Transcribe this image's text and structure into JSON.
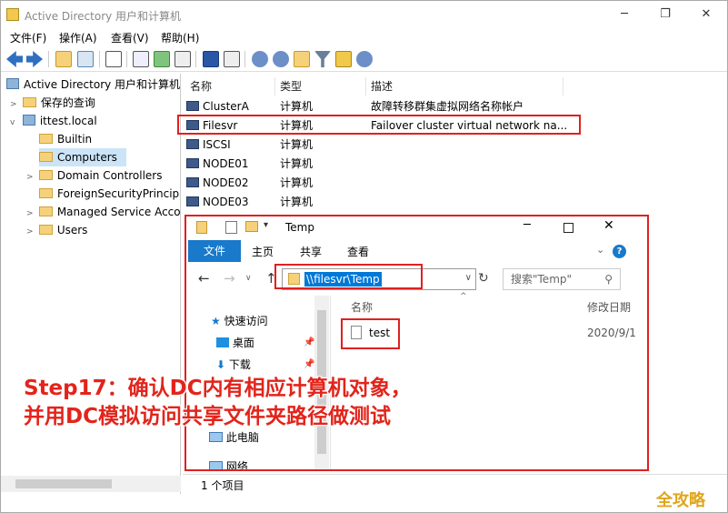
{
  "window": {
    "title": "Active Directory 用户和计算机",
    "minimize": "─",
    "maximize": "❐",
    "close": "✕"
  },
  "menu": [
    "文件(F)",
    "操作(A)",
    "查看(V)",
    "帮助(H)"
  ],
  "tree": {
    "root": "Active Directory 用户和计算机",
    "saved_queries": "保存的查询",
    "domain": "ittest.local",
    "children": [
      "Builtin",
      "Computers",
      "Domain Controllers",
      "ForeignSecurityPrincipa",
      "Managed Service Acco",
      "Users"
    ]
  },
  "list": {
    "headers": [
      "名称",
      "类型",
      "描述"
    ],
    "rows": [
      {
        "name": "ClusterA",
        "type": "计算机",
        "desc": "故障转移群集虚拟网络名称帐户"
      },
      {
        "name": "Filesvr",
        "type": "计算机",
        "desc": "Failover cluster virtual network na..."
      },
      {
        "name": "ISCSI",
        "type": "计算机",
        "desc": ""
      },
      {
        "name": "NODE01",
        "type": "计算机",
        "desc": ""
      },
      {
        "name": "NODE02",
        "type": "计算机",
        "desc": ""
      },
      {
        "name": "NODE03",
        "type": "计算机",
        "desc": ""
      }
    ]
  },
  "explorer": {
    "title": "Temp",
    "tabs": [
      "文件",
      "主页",
      "共享",
      "查看"
    ],
    "address": "\\\\filesvr\\Temp",
    "search_placeholder": "搜索\"Temp\"",
    "nav": [
      "快速访问",
      "桌面",
      "下载",
      "此电脑",
      "网络"
    ],
    "columns": [
      "名称",
      "修改日期"
    ],
    "file": {
      "name": "test",
      "date": "2020/9/1"
    },
    "status": "1 个项目"
  },
  "annotation": {
    "line1": "Step17：确认DC内有相应计算机对象，",
    "line2": "并用DC模拟访问共享文件夹路径做测试"
  },
  "watermark": "全攻略",
  "colors": {
    "accent": "#1979ca",
    "highlight": "#e02020",
    "caption": "#e3241b",
    "selection": "#0078d7"
  }
}
